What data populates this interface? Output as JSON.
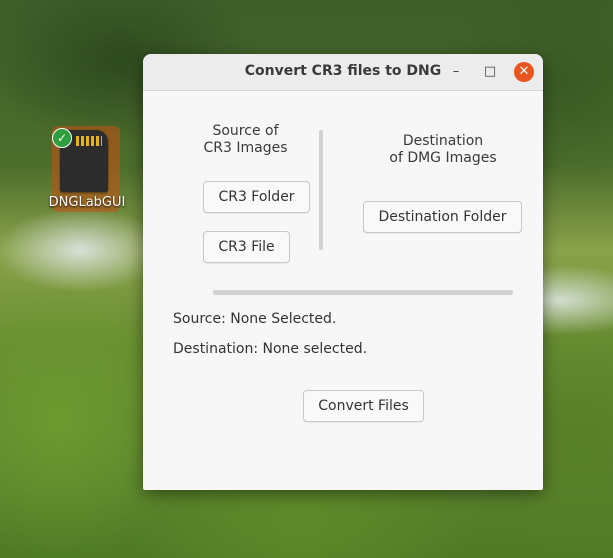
{
  "desktop": {
    "icon_label": "DNGLabGUI"
  },
  "window": {
    "title": "Convert CR3 files to DNG",
    "controls": {
      "minimize": "–",
      "maximize": "□",
      "close": "✕"
    }
  },
  "source": {
    "title_line1": "Source of",
    "title_line2": "CR3 Images",
    "folder_button": "CR3 Folder",
    "file_button": "CR3 File"
  },
  "destination": {
    "title_line1": "Destination",
    "title_line2": "of DMG Images",
    "folder_button": "Destination Folder"
  },
  "status": {
    "source": "Source: None Selected.",
    "destination": "Destination: None selected."
  },
  "actions": {
    "convert_button": "Convert Files"
  },
  "colors": {
    "close_button": "#e9541f",
    "icon_highlight": "#c85014",
    "badge": "#2f9e3e"
  }
}
